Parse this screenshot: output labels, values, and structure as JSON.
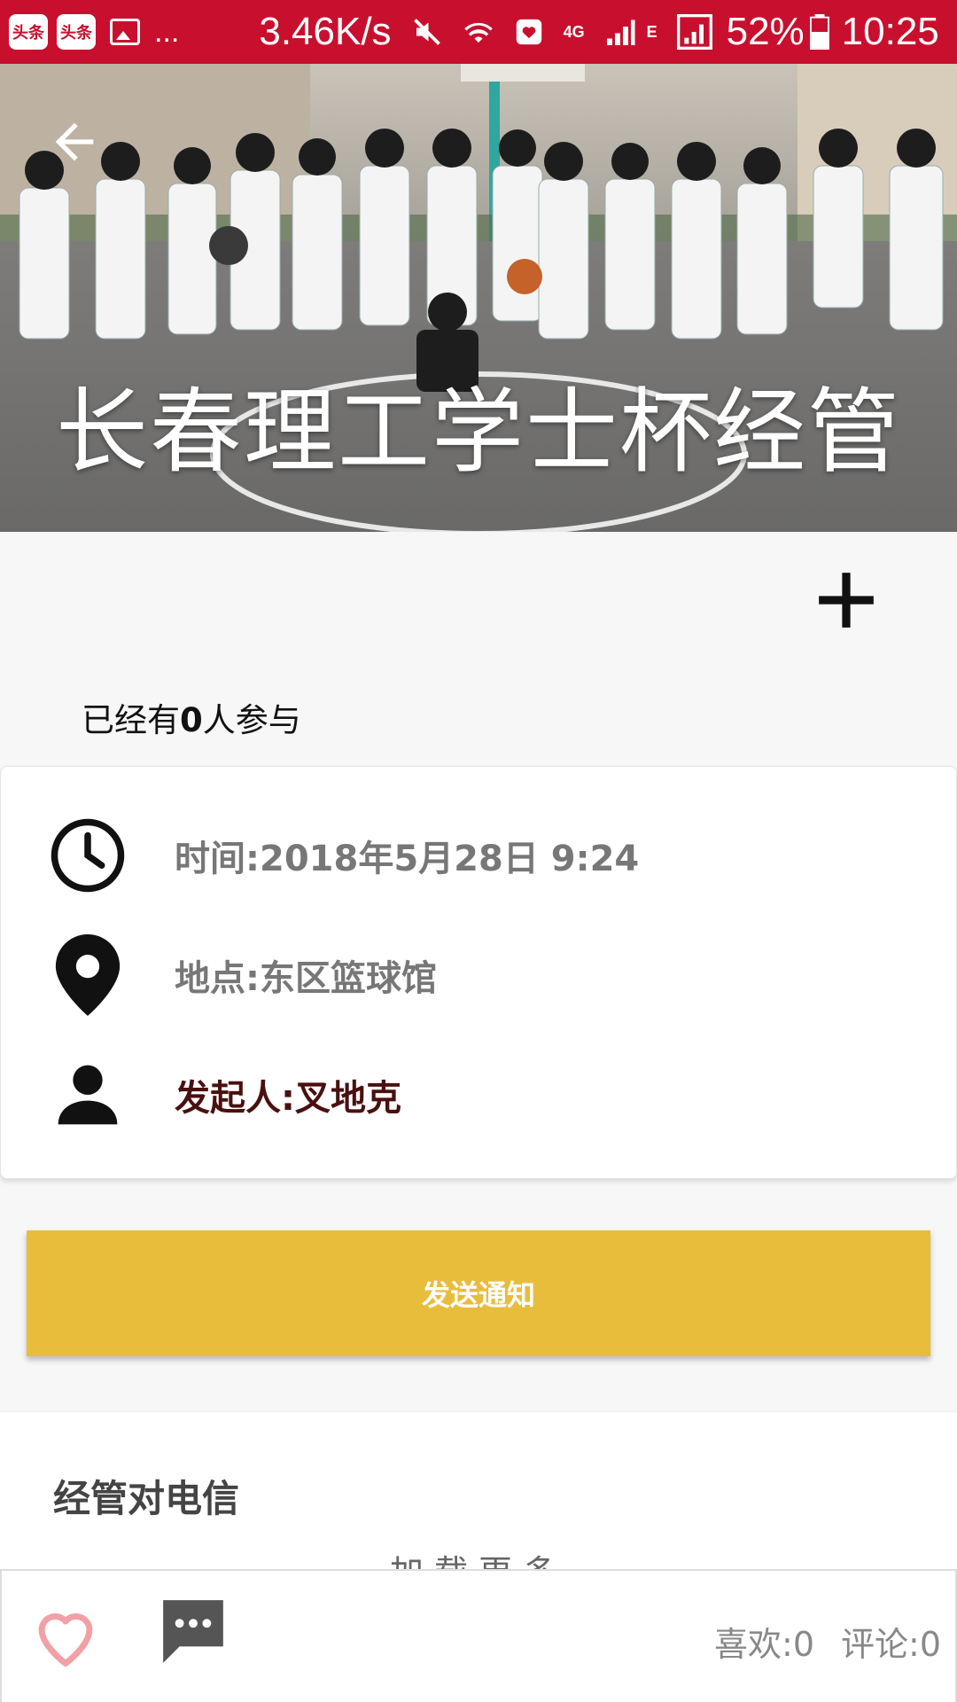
{
  "status_bar": {
    "app1": "头条",
    "app2": "头条",
    "more": "...",
    "net_speed": "3.46K/s",
    "net_type": "4G",
    "signal2_label": "E",
    "battery": "52%",
    "time": "10:25"
  },
  "hero": {
    "title": "长春理工学士杯经管"
  },
  "participation": {
    "prefix": "已经有",
    "count": "0",
    "suffix": "人参与"
  },
  "info": {
    "time": "时间:2018年5月28日 9:24",
    "location": "地点:东区篮球馆",
    "organizer": "发起人:叉地克"
  },
  "actions": {
    "send_notice": "发送通知"
  },
  "post": {
    "title": "经管对电信",
    "load_more": "加载更多"
  },
  "bottom_bar": {
    "likes": "喜欢:0",
    "comments": "评论:0"
  },
  "colors": {
    "status_bar": "#c8102e",
    "accent_button": "#e8bd3c",
    "organizer_text": "#4a1010",
    "like_heart": "#f2a0a6"
  }
}
